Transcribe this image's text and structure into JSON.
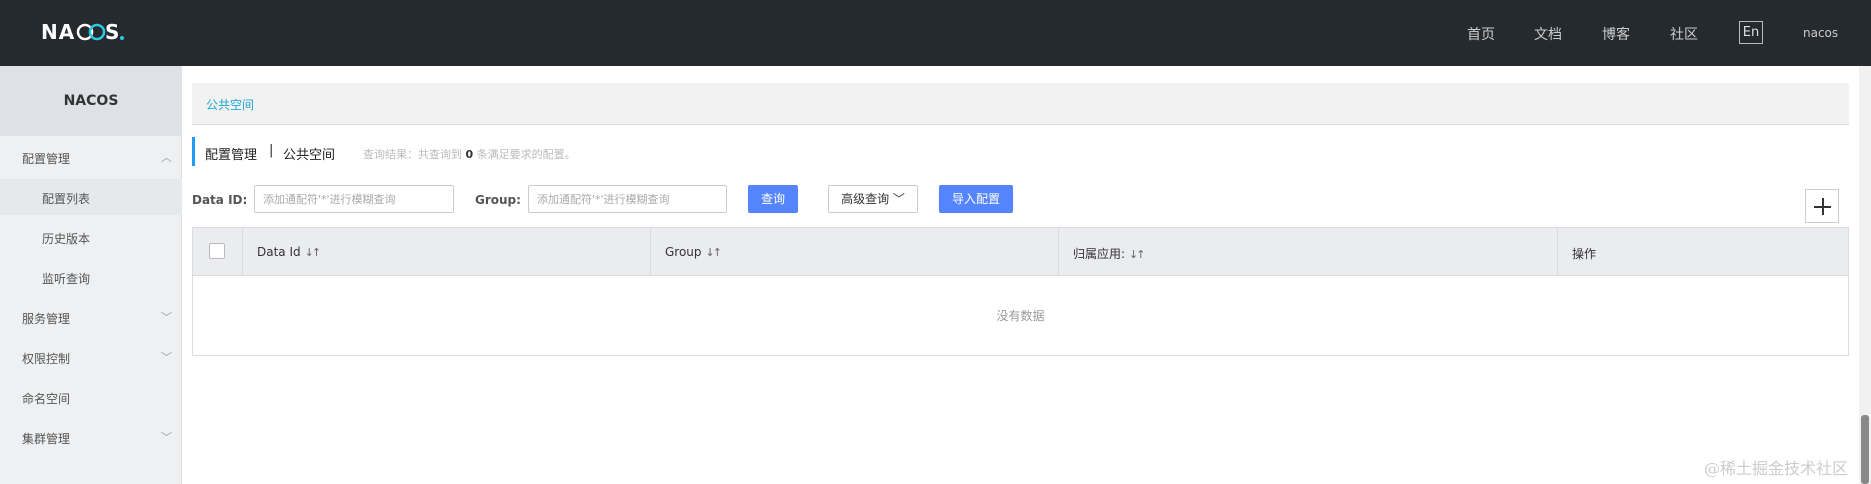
{
  "header": {
    "logo_text": "NACOS.",
    "nav": [
      "首页",
      "文档",
      "博客",
      "社区"
    ],
    "lang": "En",
    "user": "nacos"
  },
  "sidebar": {
    "title": "NACOS",
    "items": [
      {
        "label": "配置管理",
        "expanded": true
      },
      {
        "label": "配置列表",
        "sub": true,
        "active": true
      },
      {
        "label": "历史版本",
        "sub": true
      },
      {
        "label": "监听查询",
        "sub": true
      },
      {
        "label": "服务管理",
        "expanded": false
      },
      {
        "label": "权限控制",
        "expanded": false
      },
      {
        "label": "命名空间"
      },
      {
        "label": "集群管理",
        "expanded": false
      }
    ]
  },
  "breadcrumb": "公共空间",
  "title": {
    "main": "配置管理",
    "separator": "|",
    "namespace": "公共空间",
    "result_prefix": "查询结果：共查询到",
    "result_count": "0",
    "result_suffix": "条满足要求的配置。"
  },
  "filters": {
    "data_id_label": "Data ID:",
    "data_id_placeholder": "添加通配符'*'进行模糊查询",
    "group_label": "Group:",
    "group_placeholder": "添加通配符'*'进行模糊查询",
    "search_button": "查询",
    "advanced_button": "高级查询",
    "import_button": "导入配置"
  },
  "table": {
    "columns": [
      "Data Id",
      "Group",
      "归属应用:",
      "操作"
    ],
    "empty_text": "没有数据"
  },
  "watermark": "@稀土掘金技术社区",
  "colors": {
    "header_bg": "#252a2f",
    "primary": "#5584ff",
    "link": "#20a7d5"
  }
}
